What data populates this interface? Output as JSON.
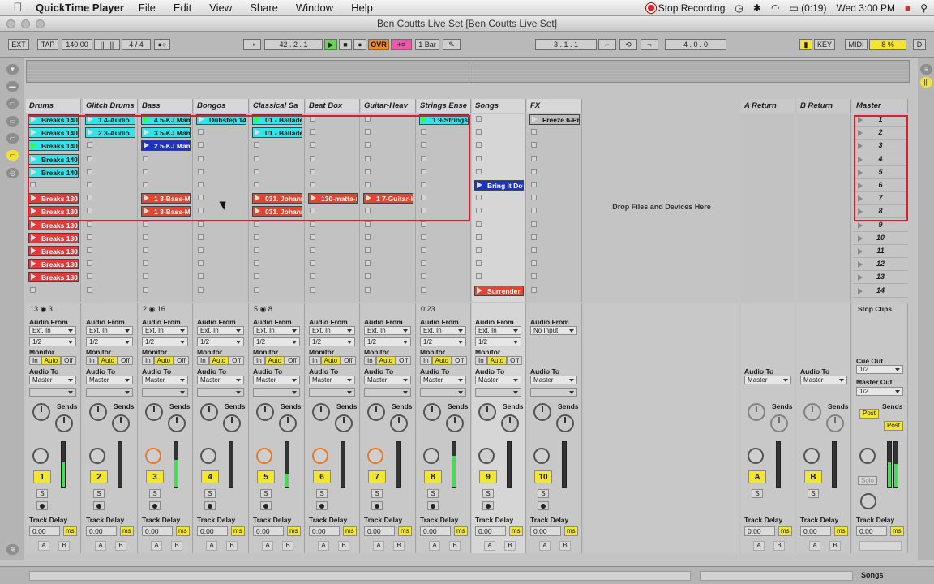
{
  "menubar": {
    "app": "QuickTime Player",
    "items": [
      "File",
      "Edit",
      "View",
      "Share",
      "Window",
      "Help"
    ],
    "recording": "Stop Recording",
    "battery": "(0:19)",
    "clock": "Wed 3:00 PM"
  },
  "window": {
    "title": "Ben Coutts Live Set  [Ben Coutts Live Set]"
  },
  "control": {
    "ext": "EXT",
    "tap": "TAP",
    "tempo": "140.00",
    "sig": "4 / 4",
    "position": "42 .  2 .  1",
    "ovr": "OVR",
    "quantize": "1 Bar",
    "loop_start": "3 .  1 .  1",
    "loop_len": "4 .  0 .  0",
    "key": "KEY",
    "midi": "MIDI",
    "cpu": "8 %",
    "d": "D"
  },
  "tracks": [
    {
      "name": "Drums",
      "clips": [
        {
          "row": 0,
          "label": "Breaks 140",
          "color": "cyan",
          "playing": false
        },
        {
          "row": 1,
          "label": "Breaks 140",
          "color": "cyan",
          "playing": false
        },
        {
          "row": 2,
          "label": "Breaks 140",
          "color": "cyan",
          "playing": true
        },
        {
          "row": 3,
          "label": "Breaks 140",
          "color": "cyan",
          "playing": false
        },
        {
          "row": 4,
          "label": "Breaks 140",
          "color": "cyan",
          "playing": false
        },
        {
          "row": 6,
          "label": "Breaks 130",
          "color": "red",
          "playing": false
        },
        {
          "row": 7,
          "label": "Breaks 130",
          "color": "red",
          "playing": false
        },
        {
          "row": 8,
          "label": "Breaks 130",
          "color": "red",
          "playing": false
        },
        {
          "row": 9,
          "label": "Breaks 130",
          "color": "red",
          "playing": false
        },
        {
          "row": 10,
          "label": "Breaks 130",
          "color": "red",
          "playing": false
        },
        {
          "row": 11,
          "label": "Breaks 130",
          "color": "red",
          "playing": false
        },
        {
          "row": 12,
          "label": "Breaks 130",
          "color": "red",
          "playing": false
        }
      ],
      "num": "1",
      "stopinfo": "13 ◉ 3",
      "audio_from": "Ext. In",
      "ch": "1/2"
    },
    {
      "name": "Glitch Drums",
      "clips": [
        {
          "row": 0,
          "label": "1 4-Audio",
          "color": "cyan",
          "playing": false
        },
        {
          "row": 1,
          "label": "2 3-Audio",
          "color": "cyan",
          "playing": false
        }
      ],
      "num": "2",
      "stopinfo": "",
      "audio_from": "Ext. In",
      "ch": "1/2"
    },
    {
      "name": "Bass",
      "clips": [
        {
          "row": 0,
          "label": "4 5-KJ Mam",
          "color": "cyan",
          "playing": true
        },
        {
          "row": 1,
          "label": "3 5-KJ Mam",
          "color": "cyan",
          "playing": false
        },
        {
          "row": 2,
          "label": "2 5-KJ Mam",
          "color": "blue",
          "playing": false
        },
        {
          "row": 6,
          "label": "1 3-Bass-Ma",
          "color": "orng",
          "playing": false
        },
        {
          "row": 7,
          "label": "1 3-Bass-Ma",
          "color": "orng",
          "playing": false
        }
      ],
      "num": "3",
      "stopinfo": "2 ◉ 16",
      "audio_from": "Ext. In",
      "ch": "1/2"
    },
    {
      "name": "Bongos",
      "clips": [
        {
          "row": 0,
          "label": "Dubstep 140",
          "color": "cyan",
          "playing": false
        }
      ],
      "num": "4",
      "stopinfo": "",
      "audio_from": "Ext. In",
      "ch": "1/2"
    },
    {
      "name": "Classical Sa",
      "clips": [
        {
          "row": 0,
          "label": "01 - Ballade",
          "color": "cyan",
          "playing": true
        },
        {
          "row": 1,
          "label": "01 - Ballade",
          "color": "cyan",
          "playing": false
        },
        {
          "row": 6,
          "label": "031. Johann",
          "color": "orng",
          "playing": false
        },
        {
          "row": 7,
          "label": "031. Johann",
          "color": "orng",
          "playing": false
        }
      ],
      "num": "5",
      "stopinfo": "5 ◉ 8",
      "audio_from": "Ext. In",
      "ch": "1/2"
    },
    {
      "name": "Beat Box",
      "clips": [
        {
          "row": 6,
          "label": "130-matta-r",
          "color": "orng",
          "playing": false
        }
      ],
      "num": "6",
      "stopinfo": "",
      "audio_from": "Ext. In",
      "ch": "1/2"
    },
    {
      "name": "Guitar-Heav",
      "clips": [
        {
          "row": 6,
          "label": "1 7-Guitar-H",
          "color": "orng",
          "playing": false
        }
      ],
      "num": "7",
      "stopinfo": "",
      "audio_from": "Ext. In",
      "ch": "1/2"
    },
    {
      "name": "Strings Ense",
      "clips": [
        {
          "row": 0,
          "label": "1 9-Strings",
          "color": "cyan",
          "playing": true
        }
      ],
      "num": "8",
      "stopinfo": "0:23",
      "audio_from": "Ext. In",
      "ch": "1/2"
    },
    {
      "name": "Songs",
      "clips": [
        {
          "row": 5,
          "label": "Bring it Dow",
          "color": "blue",
          "playing": false
        },
        {
          "row": 13,
          "label": "Surrender",
          "color": "orng",
          "playing": false
        }
      ],
      "num": "9",
      "stopinfo": "",
      "audio_from": "Ext. In",
      "ch": "1/2"
    },
    {
      "name": "FX",
      "clips": [
        {
          "row": 0,
          "label": "Freeze 6-Pri",
          "color": "gray",
          "playing": false
        }
      ],
      "num": "10",
      "stopinfo": "",
      "audio_from": "No Input",
      "ch": ""
    }
  ],
  "returns": [
    {
      "name": "A Return",
      "label": "A"
    },
    {
      "name": "B Return",
      "label": "B"
    }
  ],
  "master": {
    "name": "Master",
    "scenes": [
      "1",
      "2",
      "3",
      "4",
      "5",
      "6",
      "7",
      "8",
      "9",
      "10",
      "11",
      "12",
      "13",
      "14"
    ],
    "stop_clips": "Stop Clips",
    "cue_out": "Cue Out",
    "cue_ch": "1/2",
    "master_out": "Master Out",
    "master_ch": "1/2",
    "solo": "Solo",
    "post": "Post"
  },
  "labels": {
    "drop": "Drop Files and Devices Here",
    "audio_from": "Audio From",
    "monitor": "Monitor",
    "in": "In",
    "auto": "Auto",
    "off": "Off",
    "audio_to": "Audio To",
    "master": "Master",
    "sends": "Sends",
    "track_delay": "Track Delay",
    "delay_value": "0.00",
    "ms": "ms",
    "s": "S",
    "a": "A",
    "b": "B"
  },
  "status": {
    "view": "Songs"
  }
}
